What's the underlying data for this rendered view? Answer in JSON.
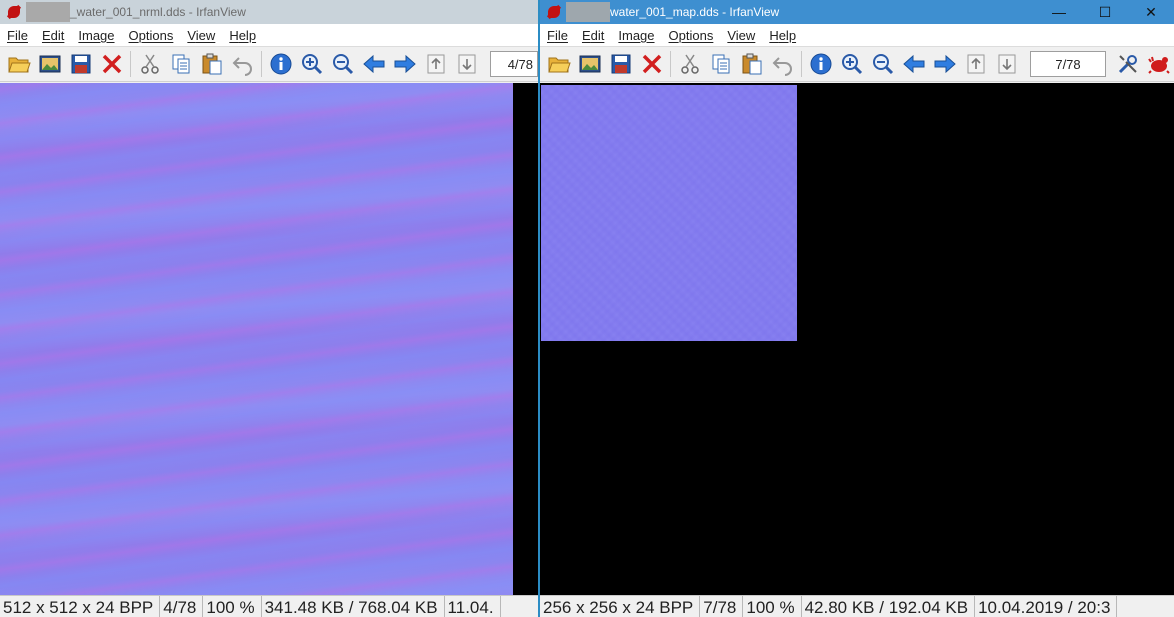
{
  "left_window": {
    "title": "_water_001_nrml.dds - IrfanView",
    "menu": [
      {
        "u": "F",
        "rest": "ile"
      },
      {
        "u": "E",
        "rest": "dit"
      },
      {
        "u": "I",
        "rest": "mage"
      },
      {
        "u": "O",
        "rest": "ptions"
      },
      {
        "u": "V",
        "rest": "iew"
      },
      {
        "u": "H",
        "rest": "elp"
      }
    ],
    "page_counter": "4/78",
    "status": {
      "dimensions": "512 x 512 x 24 BPP",
      "index": "4/78",
      "zoom": "100 %",
      "size": "341.48 KB / 768.04 KB",
      "date": "11.04."
    }
  },
  "right_window": {
    "title": "water_001_map.dds - IrfanView",
    "controls": {
      "minimize": "—",
      "maximize": "☐",
      "close": "✕"
    },
    "menu": [
      {
        "u": "F",
        "rest": "ile"
      },
      {
        "u": "E",
        "rest": "dit"
      },
      {
        "u": "I",
        "rest": "mage"
      },
      {
        "u": "O",
        "rest": "ptions"
      },
      {
        "u": "V",
        "rest": "iew"
      },
      {
        "u": "H",
        "rest": "elp"
      }
    ],
    "page_counter": "7/78",
    "status": {
      "dimensions": "256 x 256 x 24 BPP",
      "index": "7/78",
      "zoom": "100 %",
      "size": "42.80 KB / 192.04 KB",
      "date": "10.04.2019 / 20:3"
    }
  },
  "icons": [
    "open-folder-icon",
    "thumbnails-icon",
    "save-icon",
    "delete-icon",
    "cut-icon",
    "copy-icon",
    "paste-icon",
    "undo-icon",
    "info-icon",
    "zoom-in-icon",
    "zoom-out-icon",
    "previous-icon",
    "next-icon",
    "first-page-icon",
    "last-page-icon",
    "settings-icon",
    "irfanview-logo-icon"
  ],
  "colors": {
    "accent_titlebar": "#3e8fd0",
    "inactive_titlebar": "#c9d3da",
    "texture": "#8a82ee"
  }
}
